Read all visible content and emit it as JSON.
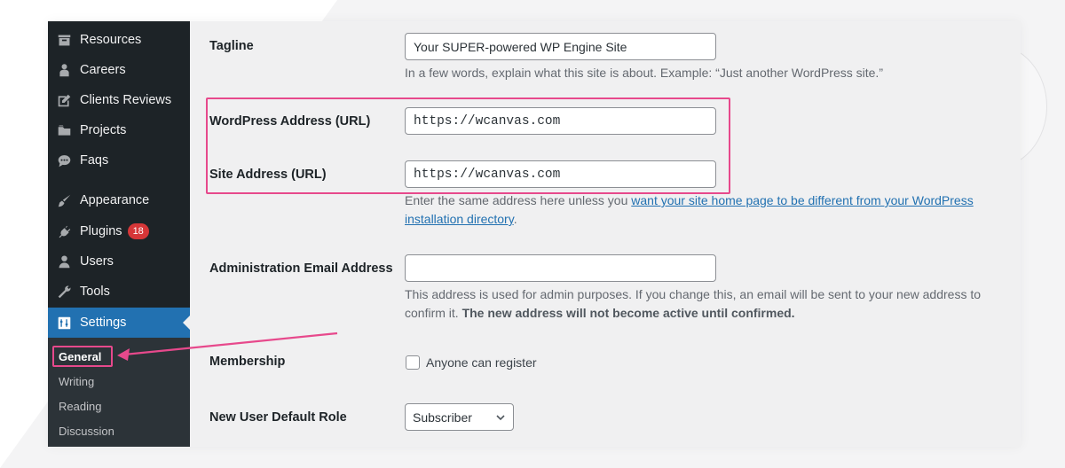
{
  "sidebar": {
    "items": [
      {
        "label": "Resources",
        "icon": "archive-icon"
      },
      {
        "label": "Careers",
        "icon": "person-icon"
      },
      {
        "label": "Clients Reviews",
        "icon": "edit-icon"
      },
      {
        "label": "Projects",
        "icon": "folder-icon"
      },
      {
        "label": "Faqs",
        "icon": "chat-icon"
      },
      {
        "label": "Appearance",
        "icon": "brush-icon"
      },
      {
        "label": "Plugins",
        "icon": "plug-icon",
        "badge": "18"
      },
      {
        "label": "Users",
        "icon": "user-icon"
      },
      {
        "label": "Tools",
        "icon": "wrench-icon"
      },
      {
        "label": "Settings",
        "icon": "settings-icon"
      }
    ],
    "submenu": [
      "General",
      "Writing",
      "Reading",
      "Discussion"
    ]
  },
  "form": {
    "tagline": {
      "label": "Tagline",
      "value": "Your SUPER-powered WP Engine Site",
      "description": "In a few words, explain what this site is about. Example: “Just another WordPress site.”"
    },
    "wp_address": {
      "label": "WordPress Address (URL)",
      "value": "https://wcanvas.com"
    },
    "site_address": {
      "label": "Site Address (URL)",
      "value": "https://wcanvas.com",
      "description_prefix": "Enter the same address here unless you ",
      "description_link": "want your site home page to be different from your WordPress installation directory",
      "description_suffix": "."
    },
    "admin_email": {
      "label": "Administration Email Address",
      "value": "",
      "description_prefix": "This address is used for admin purposes. If you change this, an email will be sent to your new address to confirm it. ",
      "description_strong": "The new address will not become active until confirmed."
    },
    "membership": {
      "label": "Membership",
      "checkbox_label": "Anyone can register",
      "checked": false
    },
    "default_role": {
      "label": "New User Default Role",
      "selected": "Subscriber"
    }
  },
  "colors": {
    "accent": "#2271b1",
    "highlight": "#e7498c",
    "badge": "#d63638",
    "sidebar": "#1d2327"
  }
}
